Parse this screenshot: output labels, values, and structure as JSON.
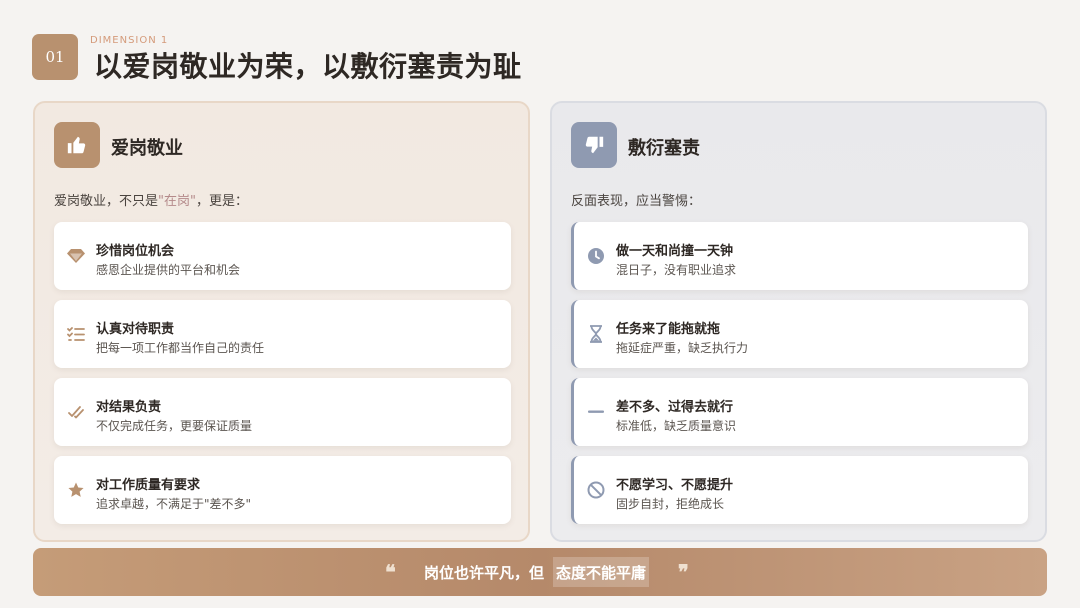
{
  "header": {
    "number": "01",
    "dimension_label": "DIMENSION 1",
    "title": "以爱岗敬业为荣，以敷衍塞责为耻"
  },
  "left_panel": {
    "icon": "thumbs-up-icon",
    "title": "爱岗敬业",
    "subtitle_pre": "爱岗敬业，不只是",
    "subtitle_hl": "\"在岗\"",
    "subtitle_post": "，更是：",
    "items": [
      {
        "icon": "diamond-icon",
        "title": "珍惜岗位机会",
        "desc": "感恩企业提供的平台和机会"
      },
      {
        "icon": "task-list-icon",
        "title": "认真对待职责",
        "desc": "把每一项工作都当作自己的责任"
      },
      {
        "icon": "double-check-icon",
        "title": "对结果负责",
        "desc": "不仅完成任务，更要保证质量"
      },
      {
        "icon": "star-icon",
        "title": "对工作质量有要求",
        "desc": "追求卓越，不满足于\"差不多\""
      }
    ]
  },
  "right_panel": {
    "icon": "thumbs-down-icon",
    "title": "敷衍塞责",
    "subtitle": "反面表现，应当警惕：",
    "items": [
      {
        "icon": "clock-icon",
        "title": "做一天和尚撞一天钟",
        "desc": "混日子，没有职业追求"
      },
      {
        "icon": "hourglass-icon",
        "title": "任务来了能拖就拖",
        "desc": "拖延症严重，缺乏执行力"
      },
      {
        "icon": "minus-icon",
        "title": "差不多、过得去就行",
        "desc": "标准低，缺乏质量意识"
      },
      {
        "icon": "ban-icon",
        "title": "不愿学习、不愿提升",
        "desc": "固步自封，拒绝成长"
      }
    ]
  },
  "footer": {
    "open_quote": "❝",
    "text": "岗位也许平凡，但",
    "highlight": "态度不能平庸",
    "close_quote": "❞"
  },
  "colors": {
    "accent_brown": "#b8916f",
    "accent_slate": "#8f9ab1"
  }
}
